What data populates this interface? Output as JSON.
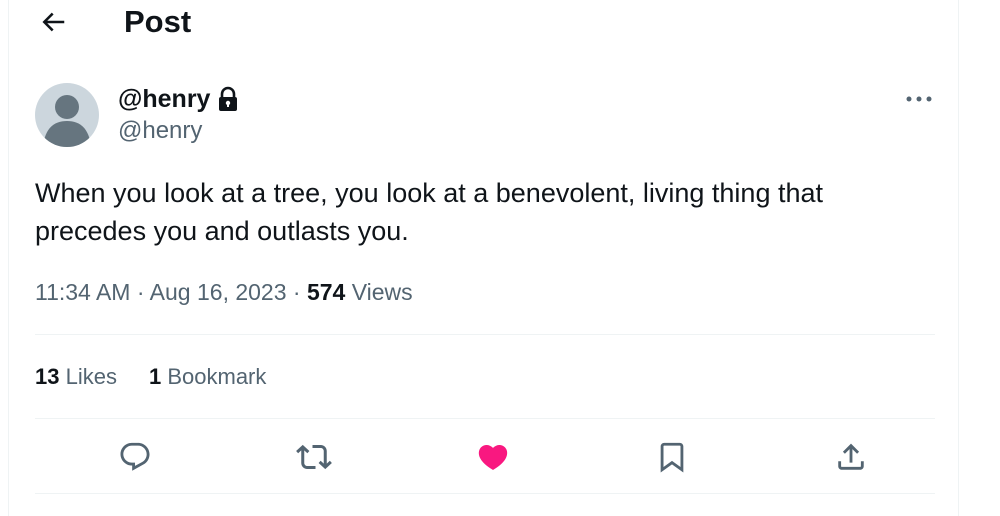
{
  "header": {
    "title": "Post",
    "back_icon": "arrow-left-icon"
  },
  "author": {
    "display_name": "@henry",
    "handle": "@henry",
    "protected_icon": "lock-icon",
    "avatar_icon": "default-avatar-icon"
  },
  "post": {
    "text": "When you look at a tree, you look at a benevolent, living thing that\nprecedes you and outlasts you.",
    "time": "11:34 AM",
    "separator": "·",
    "date": "Aug 16, 2023",
    "views_count": "574",
    "views_label": "Views"
  },
  "stats": {
    "likes_count": "13",
    "likes_label": "Likes",
    "bookmarks_count": "1",
    "bookmarks_label": "Bookmark"
  },
  "actions": [
    {
      "name": "reply",
      "icon": "reply-icon"
    },
    {
      "name": "repost",
      "icon": "repost-icon"
    },
    {
      "name": "like",
      "icon": "heart-filled-icon",
      "active": true
    },
    {
      "name": "bookmark",
      "icon": "bookmark-icon"
    },
    {
      "name": "share",
      "icon": "share-icon"
    }
  ],
  "colors": {
    "text_primary": "#0f1419",
    "text_secondary": "#536471",
    "like_active": "#f91880",
    "border": "#eff3f4",
    "avatar_bg": "#ccd6dd"
  }
}
